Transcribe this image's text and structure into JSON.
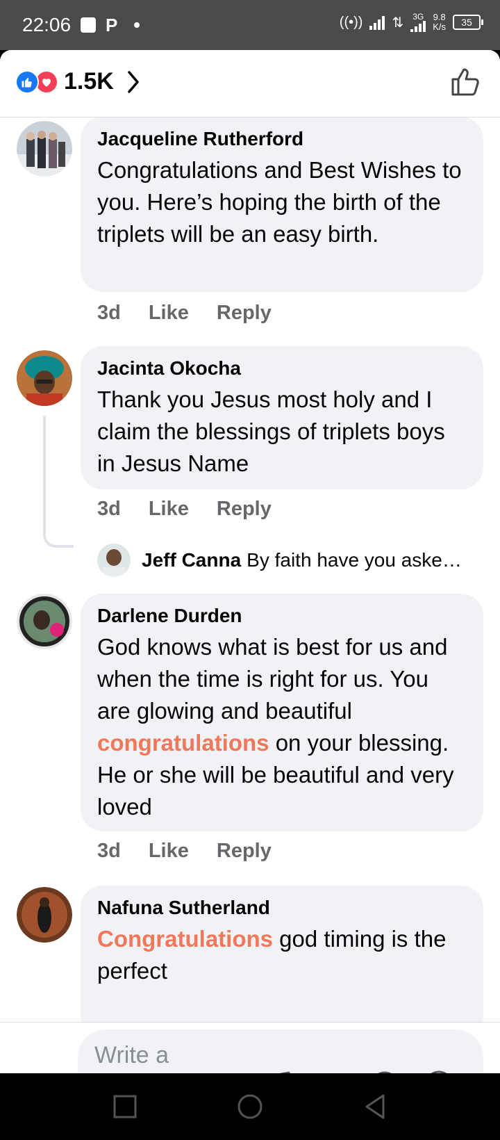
{
  "status_bar": {
    "time": "22:06",
    "network": "3G",
    "speed_value": "9.8",
    "speed_unit": "K/s",
    "battery": "35"
  },
  "header": {
    "reaction_count": "1.5K",
    "reactions": [
      "like-reaction-icon",
      "love-reaction-icon"
    ],
    "accent_color": "#1877f2",
    "love_color": "#f33e58"
  },
  "comments": [
    {
      "author": "Jacqueline Rutherford",
      "parts": [
        {
          "text": "Congratulations and Best Wishes to you. Here’s hoping the birth of the triplets will be an easy birth."
        }
      ],
      "time": "3d",
      "like_label": "Like",
      "reply_label": "Reply"
    },
    {
      "author": "Jacinta Okocha",
      "parts": [
        {
          "text": "Thank you Jesus most holy and I claim the blessings of triplets boys in Jesus Name"
        }
      ],
      "time": "3d",
      "like_label": "Like",
      "reply_label": "Reply",
      "reply_preview": {
        "author": "Jeff Canna",
        "snippet": "By faith have you aske…"
      }
    },
    {
      "author": "Darlene Durden",
      "parts": [
        {
          "text": "God knows what is best for us and when the time is right for us.   You are glowing and beautiful "
        },
        {
          "text": "congratulations",
          "highlight": true
        },
        {
          "text": " on your blessing.   He or she will be beautiful and very loved"
        }
      ],
      "time": "3d",
      "like_label": "Like",
      "reply_label": "Reply"
    },
    {
      "author": "Nafuna Sutherland",
      "parts": [
        {
          "text": "Congratulations",
          "highlight": true
        },
        {
          "text": "  god timing  is the perfect"
        }
      ]
    }
  ],
  "composer": {
    "placeholder": "Write a comment…",
    "icons": [
      "camera-icon",
      "music-icon",
      "gif-icon",
      "sticker-icon",
      "emoji-icon"
    ]
  },
  "highlight_color": "#f0785a"
}
